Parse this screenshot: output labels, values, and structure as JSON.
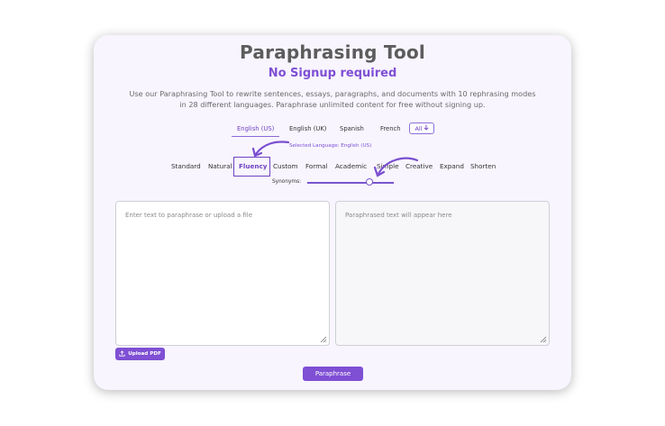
{
  "header": {
    "title": "Paraphrasing Tool",
    "subtitle": "No Signup required",
    "description": "Use our Paraphrasing Tool to rewrite sentences, essays, paragraphs, and documents with 10 rephrasing modes in 28 different languages. Paraphrase unlimited content for free without signing up."
  },
  "languages": {
    "tabs": [
      "English (US)",
      "English (UK)",
      "Spanish",
      "French"
    ],
    "active": "English (US)",
    "all_label": "All",
    "all_icon": "arrow-down-icon",
    "selected_text": "Selected Language: English (US)"
  },
  "modes": {
    "items": [
      "Standard",
      "Natural",
      "Fluency",
      "Custom",
      "Formal",
      "Academic",
      "Simple",
      "Creative",
      "Expand",
      "Shorten"
    ],
    "active": "Fluency"
  },
  "synonyms": {
    "label": "Synonyms:",
    "level_fraction": 0.72
  },
  "input": {
    "placeholder": "Enter text to paraphrase or upload a file"
  },
  "output": {
    "placeholder": "Paraphrased text will appear here"
  },
  "actions": {
    "upload_label": "Upload PDF",
    "upload_icon": "upload-icon",
    "paraphrase_label": "Paraphrase"
  },
  "colors": {
    "accent": "#7f4fd4",
    "card_bg": "#f8f5fe"
  }
}
